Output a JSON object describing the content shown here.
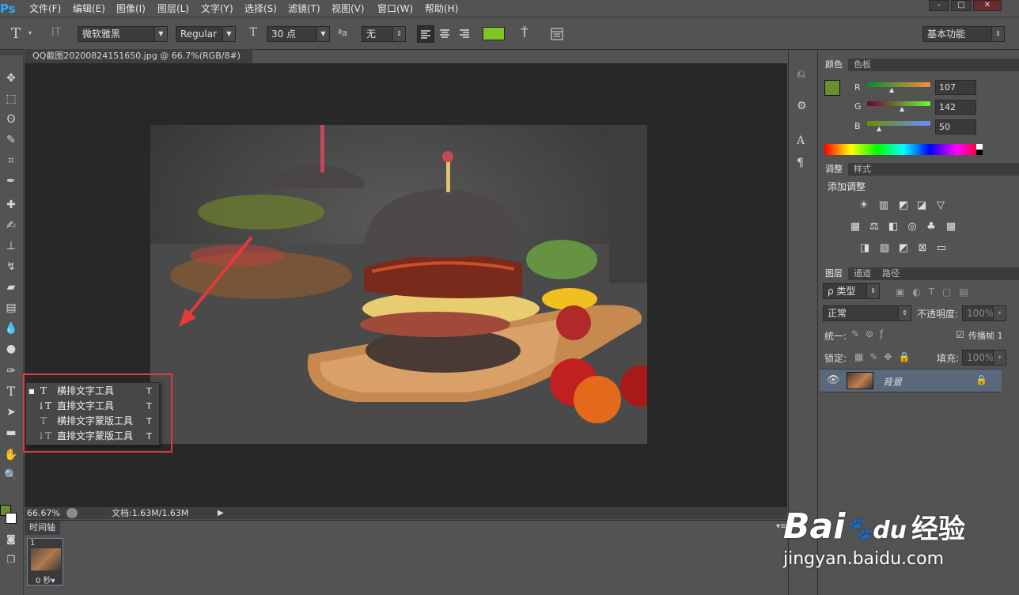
{
  "app": {
    "logo": "Ps"
  },
  "menu": [
    "文件(F)",
    "编辑(E)",
    "图像(I)",
    "图层(L)",
    "文字(Y)",
    "选择(S)",
    "滤镜(T)",
    "视图(V)",
    "窗口(W)",
    "帮助(H)"
  ],
  "window_controls": [
    "–",
    "□",
    "✕"
  ],
  "options": {
    "font_family": "微软雅黑",
    "font_style": "Regular",
    "font_size": "30 点",
    "aa_label": "ªa",
    "antialias": "无",
    "text_color": "#7dc623",
    "workspace": "基本功能"
  },
  "document": {
    "tab_title": "QQ截图20200824151650.jpg @ 66.7%(RGB/8#)",
    "close": "×",
    "zoom": "66.67%",
    "doc_info": "文档:1.63M/1.63M"
  },
  "flyout": {
    "items": [
      {
        "label": "横排文字工具",
        "shortcut": "T",
        "icon": "T",
        "selected": true
      },
      {
        "label": "直排文字工具",
        "shortcut": "T",
        "icon": "↓T",
        "selected": false
      },
      {
        "label": "横排文字蒙版工具",
        "shortcut": "T",
        "icon": "T",
        "selected": false
      },
      {
        "label": "直排文字蒙版工具",
        "shortcut": "T",
        "icon": "↓T",
        "selected": false
      }
    ]
  },
  "timeline": {
    "tab": "时间轴",
    "frame_number": "1",
    "frame_delay": "0 秒▾"
  },
  "color_panel": {
    "tabs": [
      "颜色",
      "色板"
    ],
    "fg_color": "#6b8e32",
    "channels": [
      {
        "label": "R",
        "value": "107"
      },
      {
        "label": "G",
        "value": "142"
      },
      {
        "label": "B",
        "value": "50"
      }
    ]
  },
  "adjust_panel": {
    "tabs": [
      "调整",
      "样式"
    ],
    "title": "添加调整"
  },
  "layers_panel": {
    "tabs": [
      "图层",
      "通道",
      "路径"
    ],
    "filter": "ρ 类型",
    "blend_mode": "正常",
    "opacity_label": "不透明度:",
    "opacity_value": "100%",
    "unify_label": "统一:",
    "propagate_label": "传播帧 1",
    "lock_label": "锁定:",
    "fill_label": "填充:",
    "fill_value": "100%",
    "layer_name": "背景"
  },
  "watermark": {
    "brand": "Bai",
    "brand_cn": "经验",
    "du": "du",
    "url": "jingyan.baidu.com"
  }
}
